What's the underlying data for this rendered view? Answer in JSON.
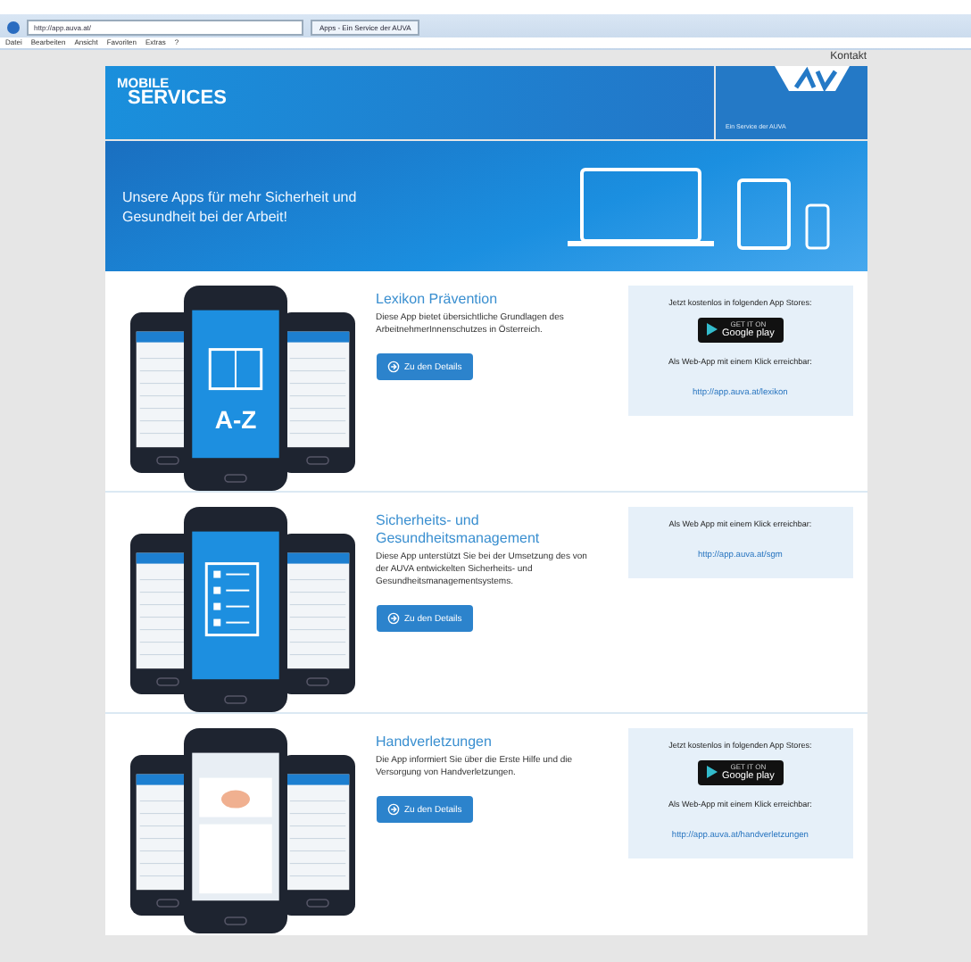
{
  "browser": {
    "address": "http://app.auva.at/",
    "tab": "Apps - Ein Service der AUVA",
    "menu": [
      "Datei",
      "Bearbeiten",
      "Ansicht",
      "Favoriten",
      "Extras",
      "?"
    ]
  },
  "top_link": "Kontakt",
  "header": {
    "title_top": "MOBILE",
    "title_bottom": "SERVICES",
    "tagline": "Ein Service der AUVA"
  },
  "hero": {
    "text": "Unsere Apps für mehr Sicherheit und Gesundheit bei der Arbeit!"
  },
  "apps": [
    {
      "kind": "lexikon",
      "screen_text": "A-Z",
      "title": "Lexikon Prävention",
      "description": "Diese App bietet übersichtliche Grundlagen des ArbeitnehmerInnenschutzes in Österreich.",
      "button": "Zu den Details",
      "store": {
        "label": "Jetzt kostenlos in folgenden App Stores:",
        "badge_small": "GET IT ON",
        "badge": "Google play"
      },
      "web_label": "Als Web-App mit einem Klick erreichbar:",
      "web_link": "http://app.auva.at/lexikon"
    },
    {
      "kind": "checklist",
      "title": "Sicherheits- und Gesundheitsmanagement",
      "description": "Diese App unterstützt Sie bei der Umsetzung des von der AUVA entwickelten Sicherheits- und Gesundheitsmanagementsystems.",
      "button": "Zu den Details",
      "web_label": "Als Web App mit einem Klick erreichbar:",
      "web_link": "http://app.auva.at/sgm"
    },
    {
      "kind": "hand",
      "title": "Handverletzungen",
      "description": "Die App informiert Sie über die Erste Hilfe und die Versorgung von Handverletzungen.",
      "button": "Zu den Details",
      "store": {
        "label": "Jetzt kostenlos in folgenden App Stores:",
        "badge_small": "GET IT ON",
        "badge": "Google play"
      },
      "web_label": "Als Web-App mit einem Klick erreichbar:",
      "web_link": "http://app.auva.at/handverletzungen"
    }
  ]
}
